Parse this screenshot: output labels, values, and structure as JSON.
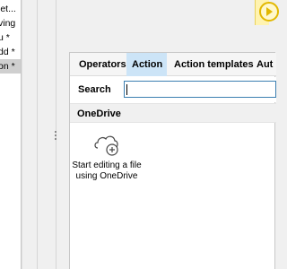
{
  "left_list": {
    "items": [
      {
        "label": "let..."
      },
      {
        "label": "ving"
      },
      {
        "label": "u *"
      },
      {
        "label": "dd *"
      },
      {
        "label": "on *",
        "selected": true
      }
    ]
  },
  "run_badge": {
    "icon": "play-icon",
    "color": "#e2b800"
  },
  "toolbox": {
    "tabs": [
      {
        "label": "Operators"
      },
      {
        "label": "Action",
        "active": true
      },
      {
        "label": "Action templates"
      },
      {
        "label": "Aut"
      }
    ],
    "search": {
      "label": "Search",
      "value": ""
    },
    "group": {
      "title": "OneDrive",
      "items": [
        {
          "label": "Start editing a file\nusing OneDrive",
          "icon": "cloud-add-icon"
        }
      ]
    }
  },
  "colors": {
    "active_tab": "#cce4f7",
    "input_border": "#3c7fb1",
    "selected_row": "#cfcfcf"
  }
}
